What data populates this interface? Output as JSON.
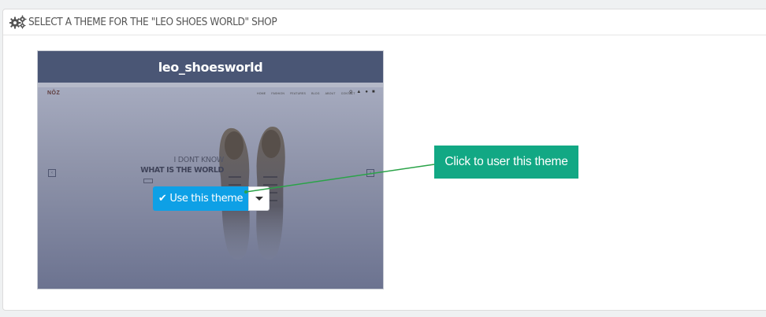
{
  "panel": {
    "heading": "SELECT A THEME FOR THE \"LEO SHOES WORLD\" SHOP",
    "heading_icon": "cogs-icon"
  },
  "theme": {
    "name": "leo_shoesworld",
    "title_bg": "#4a5675",
    "preview": {
      "logo": "NŌZ",
      "nav": [
        "HOME",
        "FASHION",
        "FEATURES",
        "BLOG",
        "ABOUT",
        "CONTACT"
      ],
      "hero_line1": "I DONT KNOW",
      "hero_line2": "WHAT IS THE WORLD"
    },
    "use_button": {
      "label": "Use this theme",
      "icon": "check-icon",
      "color": "#0ea0e6"
    },
    "dropdown_icon": "caret-down-icon"
  },
  "callout": {
    "text": "Click to user this theme",
    "color": "#12a884"
  }
}
